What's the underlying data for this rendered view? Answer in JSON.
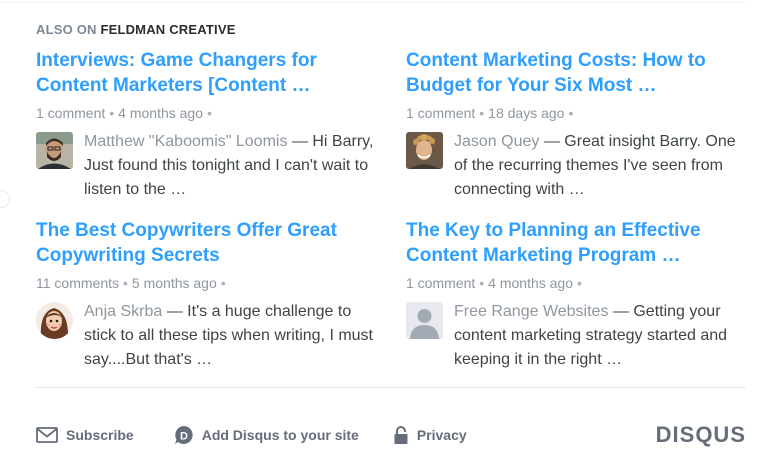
{
  "header": {
    "prefix": "ALSO ON",
    "brand": "FELDMAN CREATIVE"
  },
  "cards": [
    {
      "title": "Interviews: Game Changers for Content Marketers [Content …",
      "comments": "1 comment",
      "age": "4 months ago",
      "author": "Matthew \"Kaboomis\" Loomis",
      "snippet": "Hi Barry, Just found this tonight and I can't wait to listen to the …",
      "avatar": "man-with-beard-avatar"
    },
    {
      "title": "Content Marketing Costs: How to Budget for Your Six Most …",
      "comments": "1 comment",
      "age": "18 days ago",
      "author": "Jason Quey",
      "snippet": "Great insight Barry. One of the recurring themes I've seen from connecting with …",
      "avatar": "man-curly-hair-avatar"
    },
    {
      "title": "The Best Copywriters Offer Great Copywriting Secrets",
      "comments": "11 comments",
      "age": "5 months ago",
      "author": "Anja Skrba",
      "snippet": "It's a huge challenge to stick to all these tips when writing, I must say....But that's …",
      "avatar": "woman-illustration-avatar"
    },
    {
      "title": "The Key to Planning an Effective Content Marketing Program …",
      "comments": "1 comment",
      "age": "4 months ago",
      "author": "Free Range Websites",
      "snippet": "Getting your content marketing strategy started and keeping it in the right …",
      "avatar": "default-user-avatar"
    }
  ],
  "footer": {
    "subscribe": "Subscribe",
    "add_disqus": "Add Disqus to your site",
    "privacy": "Privacy",
    "logo": "DISQUS"
  },
  "colors": {
    "link": "#2e9fff",
    "meta": "#8e969e",
    "text": "#3e4447",
    "footer": "#656c7a"
  }
}
